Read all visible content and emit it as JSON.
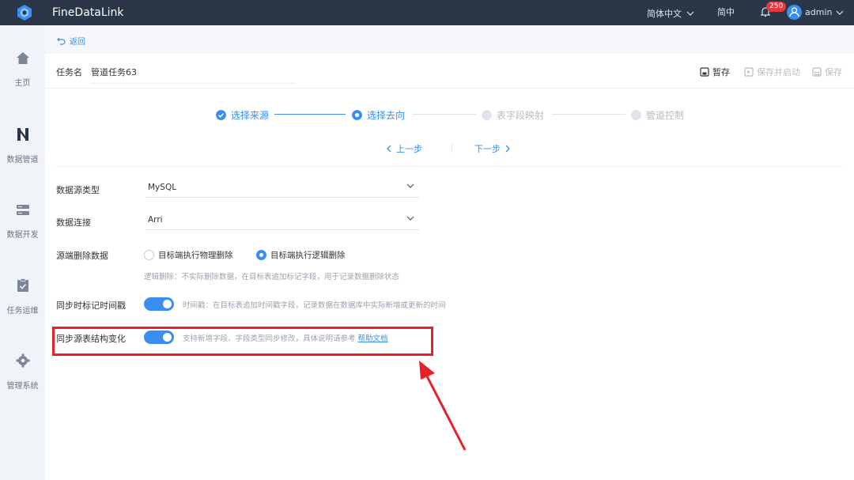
{
  "header": {
    "app_title": "FineDataLink",
    "language": "简体中文",
    "simplified": "简中",
    "notification_count": "250",
    "user_name": "admin"
  },
  "sidebar": {
    "items": [
      {
        "label": "主页",
        "icon": "home-icon"
      },
      {
        "label": "数据管道",
        "icon": "pipeline-icon"
      },
      {
        "label": "数据开发",
        "icon": "dev-icon"
      },
      {
        "label": "任务运维",
        "icon": "clipboard-check-icon"
      },
      {
        "label": "管理系统",
        "icon": "gear-icon"
      }
    ]
  },
  "nav": {
    "back_label": "返回"
  },
  "task": {
    "name_label": "任务名",
    "name_value": "管道任务63",
    "toolbar": {
      "save_draft": "暂存",
      "save_and_start": "保存并启动",
      "save": "保存"
    }
  },
  "steps": [
    {
      "label": "选择来源",
      "state": "done"
    },
    {
      "label": "选择去向",
      "state": "active"
    },
    {
      "label": "表字段映射",
      "state": "todo"
    },
    {
      "label": "管道控制",
      "state": "todo"
    }
  ],
  "step_nav": {
    "prev": "上一步",
    "next": "下一步"
  },
  "form": {
    "source_type": {
      "label": "数据源类型",
      "value": "MySQL"
    },
    "connection": {
      "label": "数据连接",
      "value": "Arri"
    },
    "delete_mode": {
      "label": "源端删除数据",
      "options": [
        "目标端执行物理删除",
        "目标端执行逻辑删除"
      ],
      "selected": "目标端执行逻辑删除",
      "hint": "逻辑删除：不实际删除数据，在目标表追加标记字段，用于记录数据删除状态"
    },
    "timestamp": {
      "label": "同步时标记时间戳",
      "enabled": true,
      "hint": "时间戳：在目标表追加时间戳字段，记录数据在数据库中实际新增或更新的时间"
    },
    "schema_change": {
      "label": "同步源表结构变化",
      "enabled": true,
      "hint": "支持新增字段、字段类型同步修改，具体说明请参考",
      "link": "帮助文档"
    }
  },
  "colors": {
    "accent": "#3b8df0",
    "topbar": "#2b3648",
    "annotation": "#e8202a"
  }
}
